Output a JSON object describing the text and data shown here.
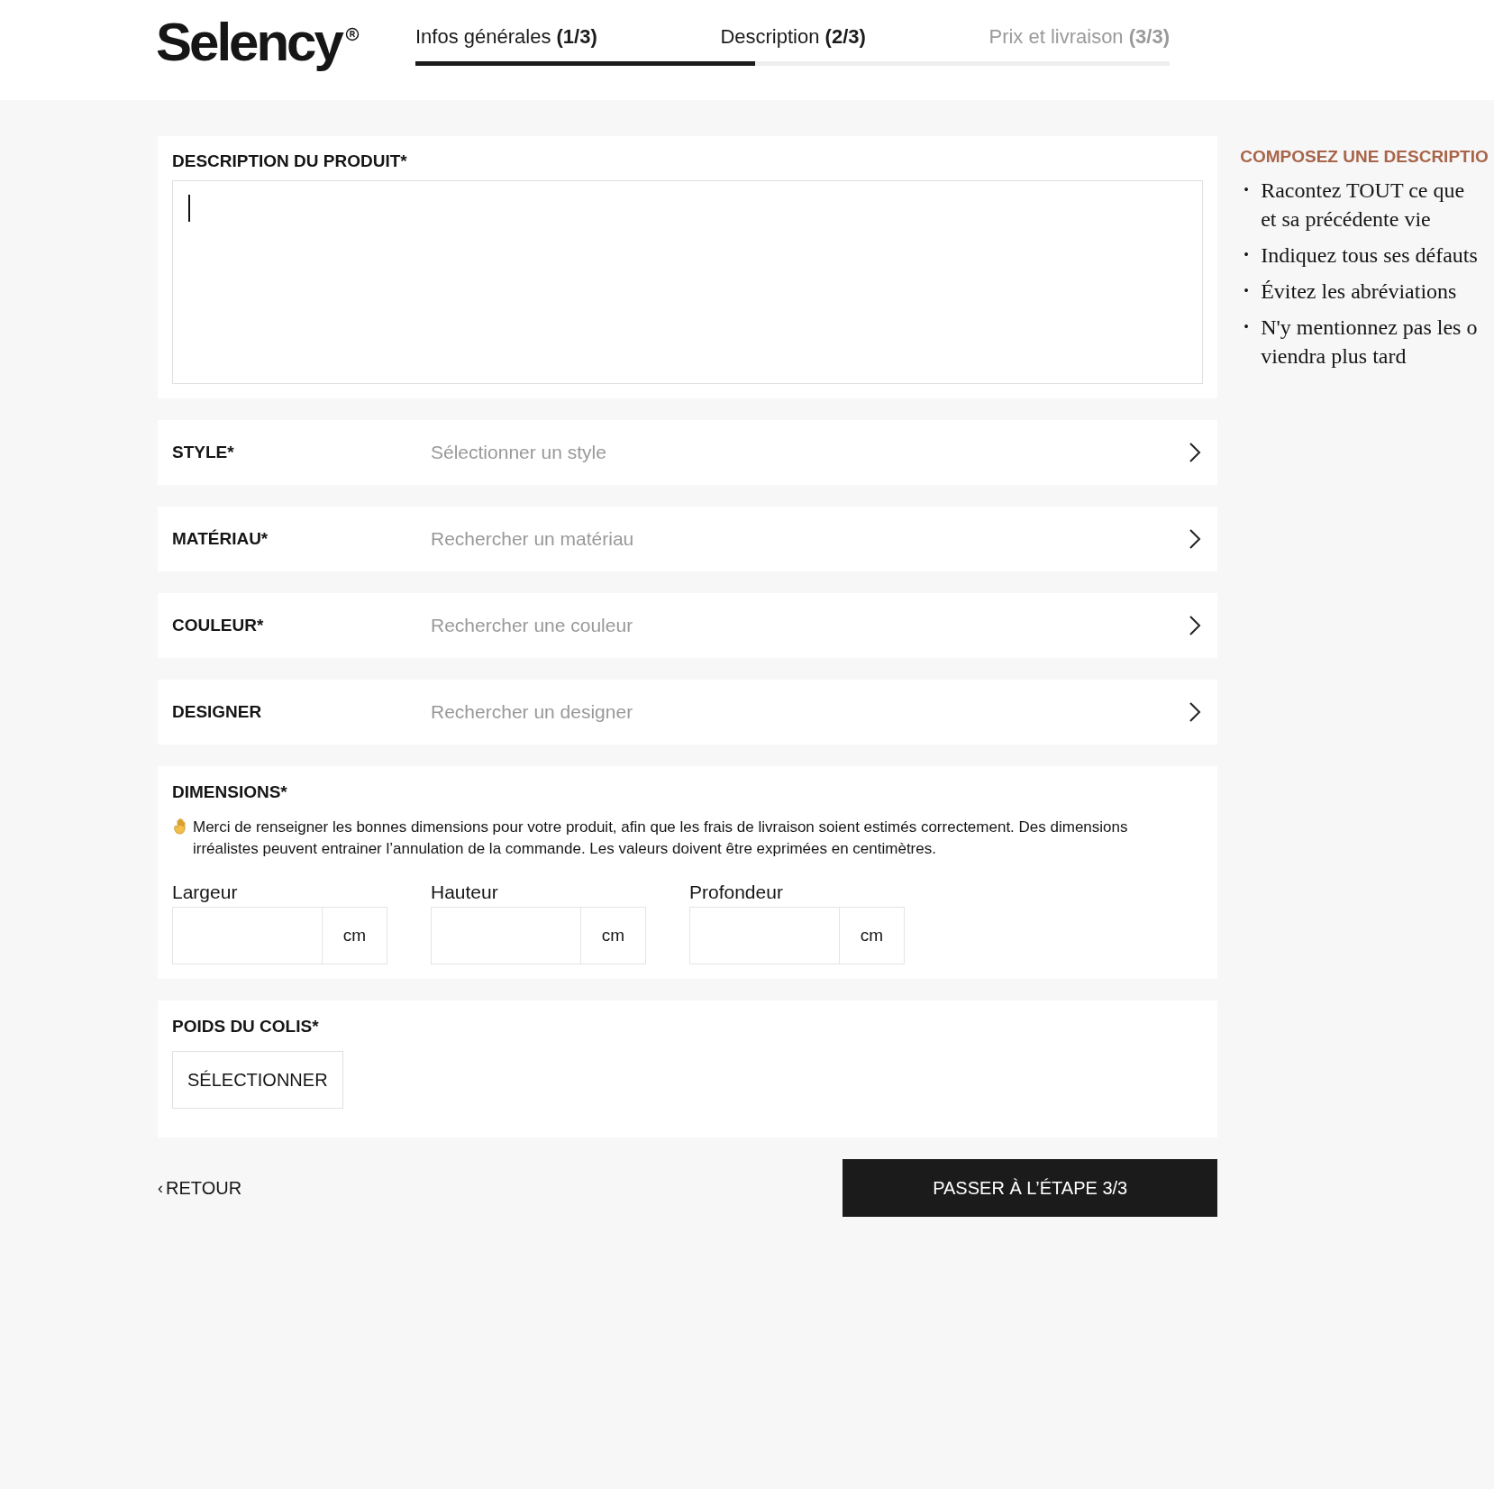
{
  "logo": {
    "text": "Selency"
  },
  "steps": [
    {
      "label": "Infos générales",
      "number": "(1/3)",
      "enabled": true
    },
    {
      "label": "Description",
      "number": "(2/3)",
      "enabled": true
    },
    {
      "label": "Prix et livraison",
      "number": "(3/3)",
      "enabled": false
    }
  ],
  "progress": {
    "level": 0.45
  },
  "description": {
    "label": "DESCRIPTION DU PRODUIT*"
  },
  "selectors": [
    {
      "label": "STYLE*",
      "placeholder": "Sélectionner un style"
    },
    {
      "label": "MATÉRIAU*",
      "placeholder": "Rechercher un matériau"
    },
    {
      "label": "COULEUR*",
      "placeholder": "Rechercher une couleur"
    },
    {
      "label": "DESIGNER",
      "placeholder": "Rechercher un designer"
    }
  ],
  "dimensions": {
    "label": "DIMENSIONS*",
    "notice": "Merci de renseigner les bonnes dimensions pour votre produit, afin que les frais de livraison soient estimés correctement. Des dimensions irréalistes peuvent entrainer l’annulation de la commande. Les valeurs doivent être exprimées en centimètres.",
    "fields": [
      {
        "label": "Largeur",
        "unit": "cm"
      },
      {
        "label": "Hauteur",
        "unit": "cm"
      },
      {
        "label": "Profondeur",
        "unit": "cm"
      }
    ]
  },
  "weight": {
    "label": "POIDS DU COLIS*",
    "button": "SÉLECTIONNER"
  },
  "back": {
    "arrow": "‹",
    "label": "RETOUR"
  },
  "next": {
    "label": "PASSER À L’ÉTAPE 3/3"
  },
  "tips": {
    "title": "COMPOSEZ UNE DESCRIPTIO",
    "items": [
      {
        "bullet": "•",
        "lines": [
          "Racontez TOUT ce que",
          "et sa précédente vie"
        ]
      },
      {
        "bullet": "•",
        "lines": [
          "Indiquez tous ses défauts"
        ]
      },
      {
        "bullet": "•",
        "lines": [
          "Évitez les abréviations"
        ]
      },
      {
        "bullet": "•",
        "lines": [
          "N'y mentionnez pas les o",
          "viendra plus tard"
        ]
      }
    ]
  }
}
